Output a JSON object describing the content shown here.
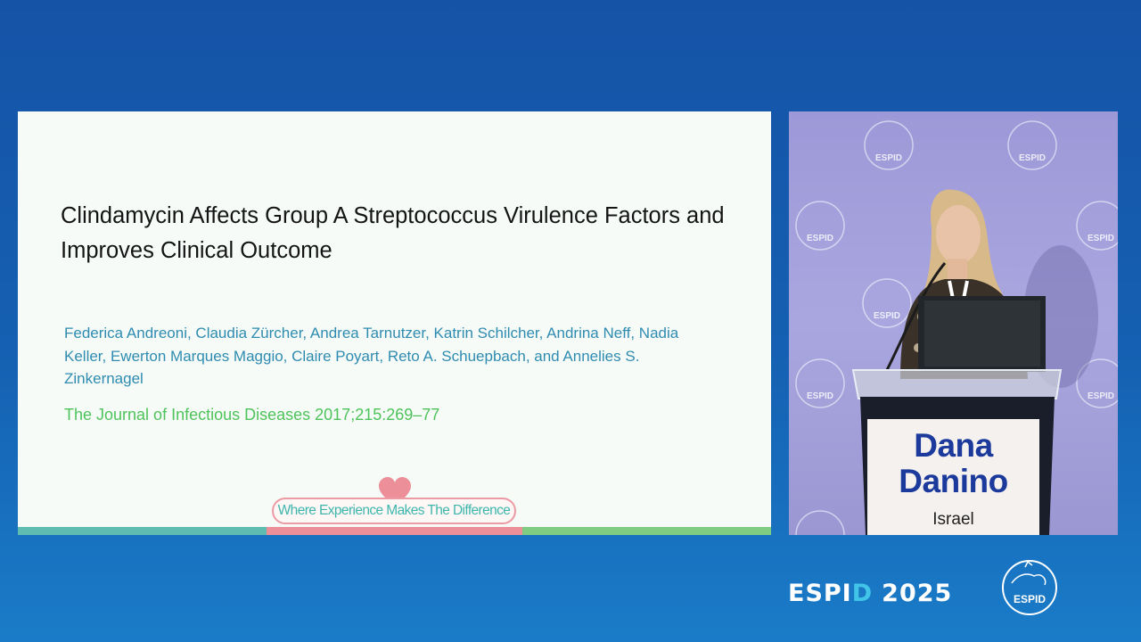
{
  "slide": {
    "title": "Clindamycin Affects Group A Streptococcus Virulence Factors and Improves Clinical Outcome",
    "authors": "Federica Andreoni, Claudia Zürcher, Andrea Tarnutzer, Katrin Schilcher, Andrina Neff, Nadia Keller, Ewerton Marques Maggio, Claire Poyart, Reto A. Schuepbach, and Annelies S. Zinkernagel",
    "journal": "The Journal of Infectious Diseases 2017;215:269–77",
    "tagline": "Where Experience Makes The Difference",
    "heart_icon": "heart-icon"
  },
  "speaker": {
    "first_name": "Dana",
    "last_name": "Danino",
    "country": "Israel"
  },
  "backdrop": {
    "logo_text": "ESPID"
  },
  "event": {
    "brand_prefix": "ESPI",
    "brand_d": "D",
    "year": "2025",
    "logo_text": "ESPID"
  },
  "colors": {
    "background": "#1560b2",
    "title": "#141414",
    "authors": "#2f8cb0",
    "journal": "#4ec35a",
    "tagline": "#3fb6ac",
    "podium_name": "#1b3a9c",
    "brand_accent": "#40c4e8"
  }
}
